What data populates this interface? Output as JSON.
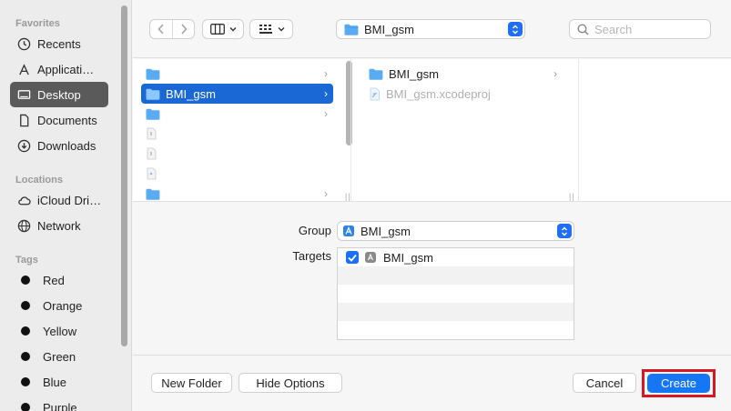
{
  "sidebar": {
    "sections": [
      {
        "title": "Favorites",
        "items": [
          "Recents",
          "Applicati…",
          "Desktop",
          "Documents",
          "Downloads"
        ]
      },
      {
        "title": "Locations",
        "items": [
          "iCloud Dri…",
          "Network"
        ]
      },
      {
        "title": "Tags",
        "items": [
          "Red",
          "Orange",
          "Yellow",
          "Green",
          "Blue",
          "Purple"
        ]
      }
    ],
    "selected": "Desktop"
  },
  "toolbar": {
    "path": "BMI_gsm",
    "search_placeholder": "Search"
  },
  "browser": {
    "col1": [
      {
        "name": "",
        "type": "folder",
        "selected": false
      },
      {
        "name": "BMI_gsm",
        "type": "folder",
        "selected": true
      },
      {
        "name": "",
        "type": "folder",
        "selected": false
      },
      {
        "name": "",
        "type": "file",
        "selected": false
      },
      {
        "name": "",
        "type": "file",
        "selected": false
      },
      {
        "name": "",
        "type": "file",
        "selected": false
      },
      {
        "name": "",
        "type": "folder",
        "selected": false
      }
    ],
    "col2": [
      {
        "name": "BMI_gsm",
        "type": "folder"
      },
      {
        "name": "BMI_gsm.xcodeproj",
        "type": "project",
        "dimmed": true
      }
    ]
  },
  "options": {
    "group_label": "Group",
    "group_value": "BMI_gsm",
    "targets_label": "Targets",
    "targets": [
      {
        "name": "BMI_gsm",
        "checked": true
      }
    ]
  },
  "buttons": {
    "new_folder": "New Folder",
    "hide_options": "Hide Options",
    "cancel": "Cancel",
    "create": "Create"
  },
  "colors": {
    "accent": "#1a67d6",
    "create_button": "#1677f6",
    "highlight_box": "#d61822",
    "folder": "#5aacf2"
  }
}
